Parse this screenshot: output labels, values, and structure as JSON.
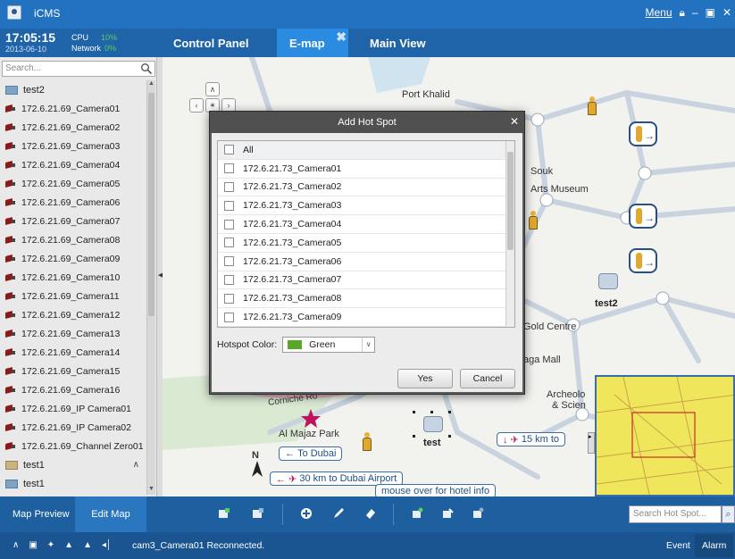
{
  "app": {
    "title": "iCMS",
    "menu_label": "Menu"
  },
  "clock": {
    "time": "17:05:15",
    "date": "2013-06-10",
    "cpu_label": "CPU",
    "cpu_value": "10%",
    "network_label": "Network",
    "network_value": "0%"
  },
  "tabs": [
    {
      "label": "Control Panel",
      "active": false
    },
    {
      "label": "E-map",
      "active": true
    },
    {
      "label": "Main View",
      "active": false
    }
  ],
  "sidebar": {
    "search_placeholder": "Search...",
    "items": [
      {
        "type": "group",
        "label": "test2"
      },
      {
        "type": "camera",
        "label": "172.6.21.69_Camera01"
      },
      {
        "type": "camera",
        "label": "172.6.21.69_Camera02"
      },
      {
        "type": "camera",
        "label": "172.6.21.69_Camera03"
      },
      {
        "type": "camera",
        "label": "172.6.21.69_Camera04"
      },
      {
        "type": "camera",
        "label": "172.6.21.69_Camera05"
      },
      {
        "type": "camera",
        "label": "172.6.21.69_Camera06"
      },
      {
        "type": "camera",
        "label": "172.6.21.69_Camera07"
      },
      {
        "type": "camera",
        "label": "172.6.21.69_Camera08"
      },
      {
        "type": "camera",
        "label": "172.6.21.69_Camera09"
      },
      {
        "type": "camera",
        "label": "172.6.21.69_Camera10"
      },
      {
        "type": "camera",
        "label": "172.6.21.69_Camera11"
      },
      {
        "type": "camera",
        "label": "172.6.21.69_Camera12"
      },
      {
        "type": "camera",
        "label": "172.6.21.69_Camera13"
      },
      {
        "type": "camera",
        "label": "172.6.21.69_Camera14"
      },
      {
        "type": "camera",
        "label": "172.6.21.69_Camera15"
      },
      {
        "type": "camera",
        "label": "172.6.21.69_Camera16"
      },
      {
        "type": "camera",
        "label": "172.6.21.69_IP Camera01"
      },
      {
        "type": "camera",
        "label": "172.6.21.69_IP Camera02"
      },
      {
        "type": "camera",
        "label": "172.6.21.69_Channel Zero01"
      },
      {
        "type": "folder",
        "label": "test1"
      },
      {
        "type": "group",
        "label": "test1"
      }
    ]
  },
  "map": {
    "labels": {
      "port_khalid": "Port Khalid",
      "souk": "Souk",
      "arts_museum": "Arts Museum",
      "gold_centre": "Gold Centre",
      "mall": "aga Mall",
      "archeology_1": "Archeolo",
      "archeology_2": "& Scien",
      "corniche": "Corniche Ro",
      "al_majaz_park": "Al Majaz Park",
      "north": "N",
      "hotspot_test2": "test2",
      "hotspot_test": "test"
    },
    "signs": {
      "to_dubai": "To Dubai",
      "dubai_airport": "30 km to Dubai Airport",
      "km15": "15 km to",
      "hotel_info": "mouse over  for hotel info"
    }
  },
  "dialog": {
    "title": "Add Hot Spot",
    "all_label": "All",
    "items": [
      "172.6.21.73_Camera01",
      "172.6.21.73_Camera02",
      "172.6.21.73_Camera03",
      "172.6.21.73_Camera04",
      "172.6.21.73_Camera05",
      "172.6.21.73_Camera06",
      "172.6.21.73_Camera07",
      "172.6.21.73_Camera08",
      "172.6.21.73_Camera09"
    ],
    "color_label": "Hotspot Color:",
    "color_value": "Green",
    "yes_label": "Yes",
    "cancel_label": "Cancel"
  },
  "toolbar": {
    "map_preview": "Map Preview",
    "edit_map": "Edit Map",
    "search_placeholder": "Search Hot Spot..."
  },
  "status": {
    "message": "cam3_Camera01 Reconnected.",
    "event": "Event",
    "alarm": "Alarm"
  },
  "colors": {
    "title_bar": "#2272c0",
    "active_tab": "#2b8be0",
    "hotspot_color": "#57a826",
    "minimap": "#f0e65c"
  }
}
